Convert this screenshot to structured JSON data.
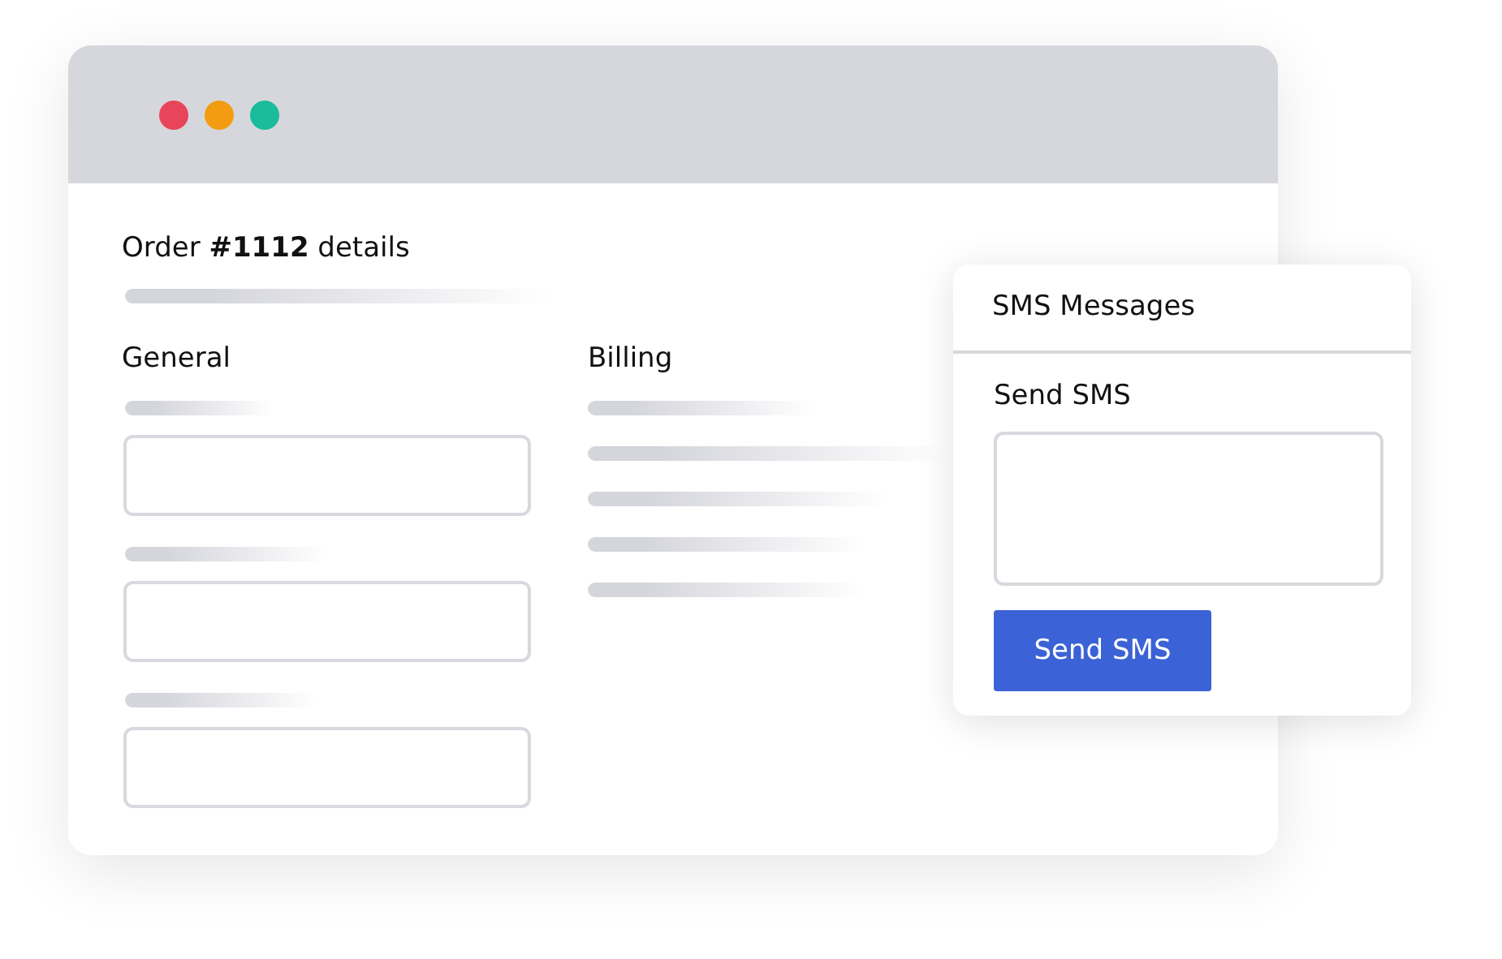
{
  "window": {
    "dots": [
      {
        "color": "#e8445a"
      },
      {
        "color": "#f39c12"
      },
      {
        "color": "#1abc9c"
      }
    ]
  },
  "order": {
    "title": "Order **#1112** details"
  },
  "general": {
    "heading": "General",
    "fields": [
      {
        "kind": "text_input"
      },
      {
        "kind": "text_input"
      },
      {
        "kind": "text_input"
      }
    ]
  },
  "billing": {
    "heading": "Billing"
  },
  "sms_panel": {
    "title": "SMS Messages",
    "label": "Send SMS",
    "button": "Send SMS"
  }
}
